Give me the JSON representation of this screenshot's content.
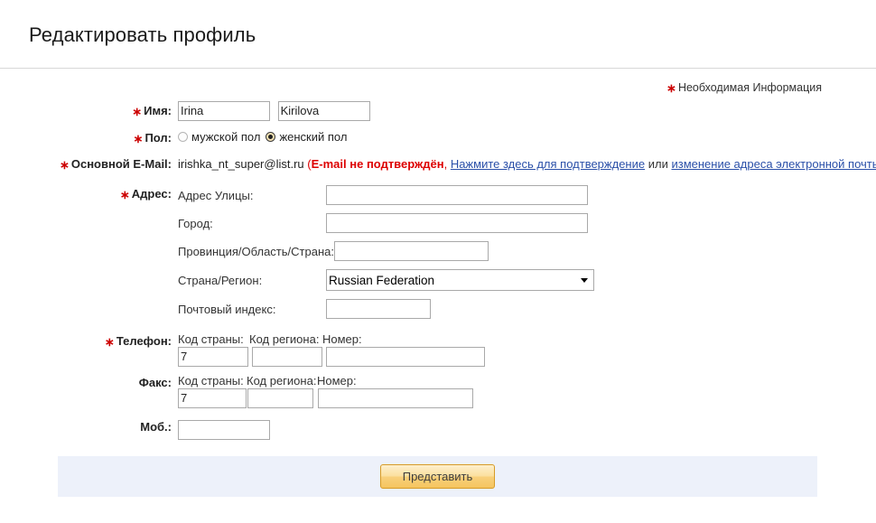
{
  "header": {
    "title": "Редактировать профиль"
  },
  "required_note": {
    "star": "∗",
    "text": "Необходимая Информация"
  },
  "form": {
    "name": {
      "label": "Имя:",
      "required": true,
      "first_value": "Irina",
      "last_value": "Kirilova"
    },
    "gender": {
      "label": "Пол:",
      "required": true,
      "options": [
        {
          "label": "мужской пол",
          "checked": false
        },
        {
          "label": "женский пол",
          "checked": true
        }
      ]
    },
    "email": {
      "label": "Основной E-Mail:",
      "required": true,
      "value": "irishka_nt_super@list.ru",
      "open_paren": "(",
      "warning": "E-mail не подтверждён",
      "comma": ",",
      "link_verify": "Нажмите здесь для подтверждение",
      "or": "или",
      "link_change": "изменение адреса электронной почты",
      "close_paren": ")"
    },
    "address": {
      "label": "Адрес:",
      "required": true,
      "street_label": "Адрес Улицы:",
      "street_value": "",
      "city_label": "Город:",
      "city_value": "",
      "province_label": "Провинция/Область/Страна:",
      "province_value": "",
      "country_label": "Страна/Регион:",
      "country_value": "Russian Federation",
      "zip_label": "Почтовый индекс:",
      "zip_value": ""
    },
    "phone": {
      "label": "Телефон:",
      "required": true,
      "country_code_label": "Код страны:",
      "country_code_value": "7",
      "area_code_label": "Код региона:",
      "area_code_value": "",
      "number_label": "Номер:",
      "number_value": ""
    },
    "fax": {
      "label": "Факс:",
      "required": false,
      "country_code_label": "Код страны:",
      "country_code_value": "7",
      "area_code_label": "Код региона:",
      "area_code_value": "",
      "number_label": "Номер:",
      "number_value": ""
    },
    "mobile": {
      "label": "Моб.:",
      "required": false,
      "value": ""
    }
  },
  "footer": {
    "submit_label": "Представить"
  },
  "colors": {
    "required_star": "#cc0000",
    "warning": "#dd0000",
    "link": "#2a4fa8",
    "footer_bg": "#edf1fa",
    "button_border": "#d79b26"
  }
}
